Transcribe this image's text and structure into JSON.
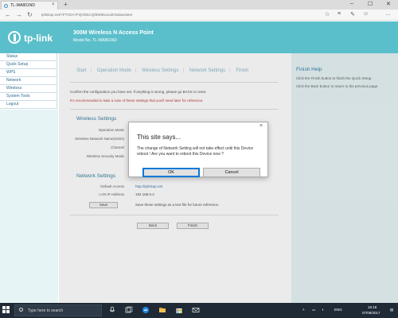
{
  "browser": {
    "tab_title": "TL-WA801ND",
    "tab_close": "×",
    "new_tab": "+",
    "win_min": "–",
    "win_max": "☐",
    "win_close": "✕",
    "back": "←",
    "forward": "→",
    "refresh": "↻",
    "url": "tplinkap.net/?PTO0A7FQOD6CQ/BW6lsocalrrDalasetster",
    "tools": [
      "☆",
      "≡",
      "✎",
      "☺",
      "…"
    ]
  },
  "header": {
    "brand": "tp-link",
    "product_title": "300M Wireless N Access Point",
    "model_label": "Model No. TL-WA801ND"
  },
  "sidebar": {
    "items": [
      {
        "label": "Status"
      },
      {
        "label": "Quick Setup"
      },
      {
        "label": "WPS"
      },
      {
        "label": "Network"
      },
      {
        "label": "Wireless"
      },
      {
        "label": "System Tools"
      },
      {
        "label": "Logout"
      }
    ]
  },
  "main": {
    "steps": [
      "Start",
      "Operation Mode",
      "Wireless Settings",
      "Network Settings",
      "Finish"
    ],
    "confirm_text": "Confirm the configuration you have set. If anything is wrong, please go BACK to reset.",
    "note_text": "It's recommended to take a note of these settings that you'll need later for reference.",
    "wireless": {
      "title": "Wireless Settings",
      "labels": [
        "Operation Mode",
        "Wireless Network Name(SSID)",
        "Channel",
        "Wireless Security Mode"
      ]
    },
    "network": {
      "title": "Network Settings",
      "default_access_label": "Default Access",
      "default_access_value": "http://tplinkap.net",
      "lan_ip_label": "LAN IP Address",
      "lan_ip_value": "192.168.0.2",
      "save_label": "Save",
      "save_hint": "Save these settings as a text file for future reference."
    },
    "back_label": "Back",
    "finish_label": "Finish"
  },
  "help": {
    "title": "Finish Help",
    "line1": "Click the Finish button to finish the Quick Setup.",
    "line2": "Click the Back button to return to the previous page."
  },
  "dialog": {
    "close": "×",
    "title": "This site says...",
    "message": "The change of Network Setting will not take effect until this Device reboot ! Are you want to reboot this Device now ?",
    "ok_label": "OK",
    "cancel_label": "Cancel"
  },
  "taskbar": {
    "search_placeholder": "Type here to search",
    "tray_lang": "ENG",
    "tray_time": "16:18",
    "tray_date": "07/08/2017"
  },
  "colors": {
    "header_bg": "#5bbfcb",
    "sidebar_link": "#2f6c90",
    "help_bg": "#e7f4f6",
    "note_red": "#c04040",
    "taskbar_bg": "#1f2a36",
    "dialog_ok_border": "#0078d7"
  }
}
